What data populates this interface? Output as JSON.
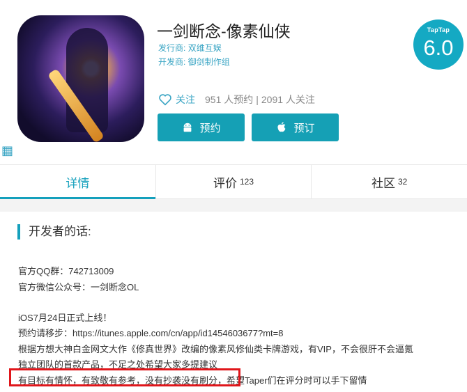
{
  "app": {
    "title": "一剑断念-像素仙侠",
    "publisher_label": "发行商:",
    "publisher": "双维互娱",
    "developer_label": "开发商:",
    "developer": "御剑制作组"
  },
  "rating": {
    "brand": "TapTap",
    "score": "6.0"
  },
  "follow": {
    "label": "关注",
    "reservations": "951 人预约",
    "separator": "|",
    "followers": "2091 人关注"
  },
  "buttons": {
    "preorder": "预约",
    "order": "预订"
  },
  "tabs": [
    {
      "label": "详情",
      "count": ""
    },
    {
      "label": "评价",
      "count": "123"
    },
    {
      "label": "社区",
      "count": "32"
    }
  ],
  "section": {
    "title": "开发者的话:",
    "lines": [
      "官方QQ群：742713009",
      "官方微信公众号：一剑断念OL",
      "iOS7月24日正式上线！",
      "预约请移步：https://itunes.apple.com/cn/app/id1454603677?mt=8",
      "根据方想大神白金网文大作《修真世界》改编的像素风修仙类卡牌游戏，有VIP，不会很肝不会逼氪",
      "独立团队的首款产品，不足之处希望大家多提建议",
      "有目标有情怀，有致敬有参考，没有抄袭没有刷分，希望Taper们在评分时可以手下留情"
    ]
  },
  "colors": {
    "accent": "#14a0bc",
    "highlight": "#e0161b"
  }
}
